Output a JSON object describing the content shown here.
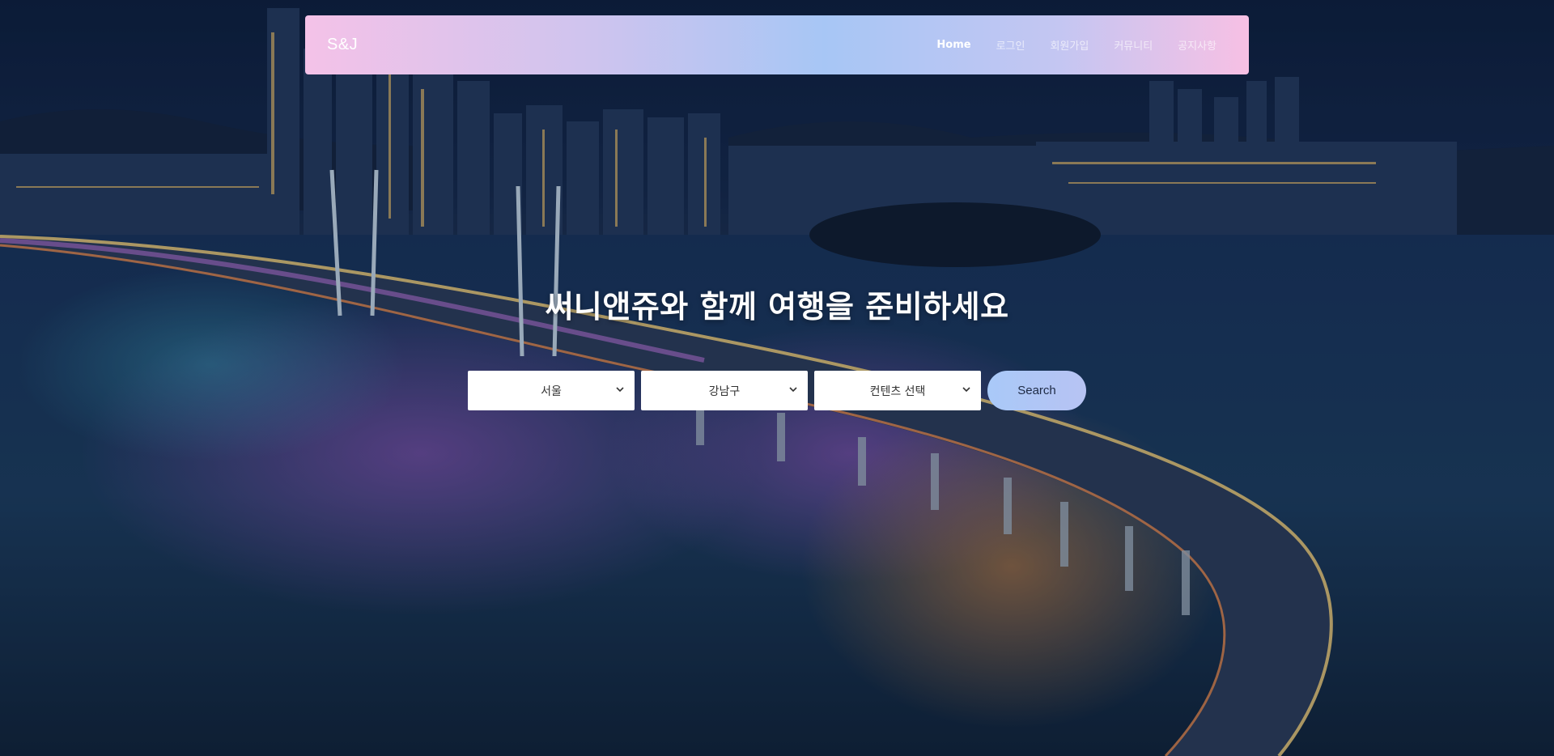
{
  "navbar": {
    "brand": "S&J",
    "links": [
      {
        "label": "Home",
        "active": true
      },
      {
        "label": "로그인",
        "active": false
      },
      {
        "label": "회원가입",
        "active": false
      },
      {
        "label": "커뮤니티",
        "active": false
      },
      {
        "label": "공지사항",
        "active": false
      }
    ]
  },
  "hero": {
    "headline": "써니앤쥬와 함께 여행을 준비하세요",
    "background": "night-city-bridge-photo"
  },
  "search": {
    "city_select": "서울",
    "district_select": "강남구",
    "content_select": "컨텐츠 선택",
    "button_label": "Search"
  },
  "colors": {
    "nav_gradient_start": "#f4c2e8",
    "nav_gradient_mid": "#a7c6f5",
    "nav_gradient_end": "#f7c0e4",
    "search_button": "#a9c9f8"
  }
}
